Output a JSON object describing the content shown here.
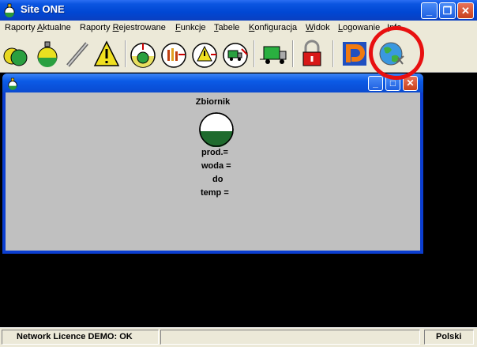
{
  "window": {
    "title": "Site ONE",
    "minimize": "_",
    "maximize": "❐",
    "close": "✕"
  },
  "menu": [
    {
      "pre": "Raporty ",
      "acc": "A",
      "post": "ktualne"
    },
    {
      "pre": "Raporty ",
      "acc": "R",
      "post": "ejestrowane"
    },
    {
      "pre": "",
      "acc": "F",
      "post": "unkcje"
    },
    {
      "pre": "",
      "acc": "T",
      "post": "abele"
    },
    {
      "pre": "",
      "acc": "K",
      "post": "onfiguracja"
    },
    {
      "pre": "",
      "acc": "W",
      "post": "idok"
    },
    {
      "pre": "",
      "acc": "L",
      "post": "ogowanie"
    },
    {
      "pre": "",
      "acc": "I",
      "post": "nfo"
    }
  ],
  "toolbar": {
    "icons": [
      "tanks-icon",
      "tank-level-icon",
      "probe-icon",
      "warning-icon",
      "gauge-tank-icon",
      "gauge-bars-icon",
      "gauge-warning-icon",
      "gauge-delivery-icon",
      "truck-icon",
      "lock-icon",
      "logo-p-icon",
      "globe-network-icon"
    ]
  },
  "child_window": {
    "minimize": "_",
    "maximize": "□",
    "close": "✕",
    "tank": {
      "title": "Zbiornik",
      "prod_label": "prod.=",
      "woda_label": "woda =",
      "do_label": "do",
      "temp_label": "temp ="
    }
  },
  "status": {
    "licence": "Network Licence DEMO: OK",
    "middle": "",
    "language": "Polski"
  },
  "colors": {
    "titlebar": "#0047d3",
    "face": "#ece9d8",
    "client": "#c0c0c0",
    "tank_liquid": "#1f6b2e",
    "annotation": "#e81010"
  }
}
